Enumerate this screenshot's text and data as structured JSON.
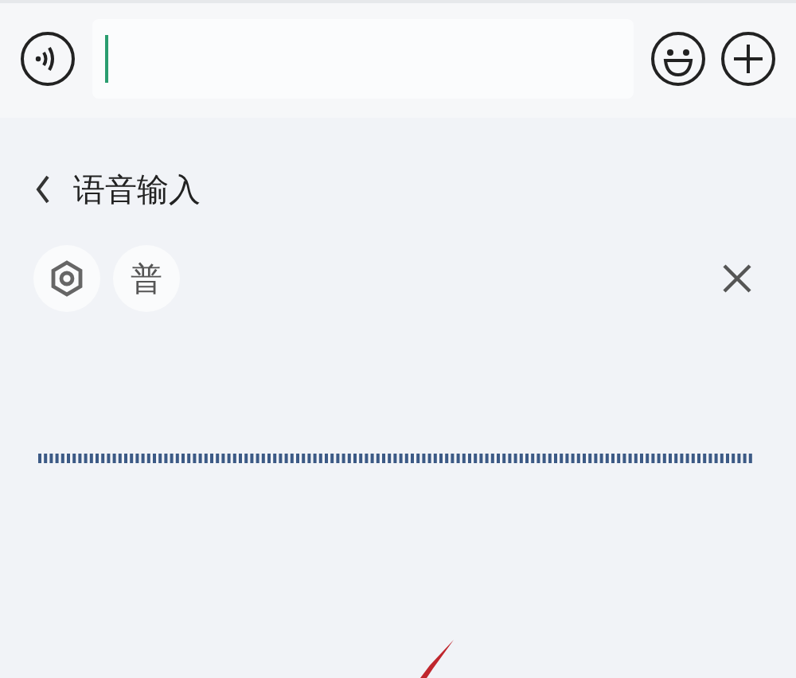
{
  "input_bar": {
    "focused": true
  },
  "panel": {
    "title": "语音输入",
    "language_button": "普"
  }
}
